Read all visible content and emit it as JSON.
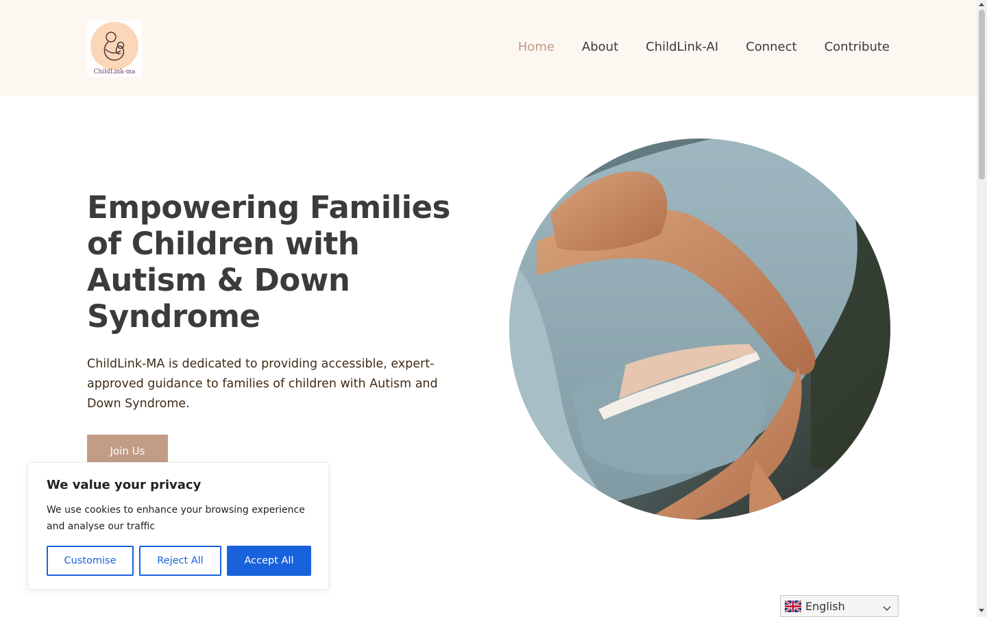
{
  "header": {
    "logo_text": "ChildLink-ma",
    "nav": [
      {
        "label": "Home",
        "active": true
      },
      {
        "label": "About"
      },
      {
        "label": "ChildLink-AI"
      },
      {
        "label": "Connect"
      },
      {
        "label": "Contribute"
      }
    ]
  },
  "hero": {
    "title": "Empowering Families of Children with Autism & Down Syndrome",
    "description": "ChildLink-MA is dedicated to providing accessible, expert-approved guidance to families of children with Autism and Down Syndrome.",
    "cta_label": "Join Us"
  },
  "cookie_banner": {
    "title": "We value your privacy",
    "text": "We use cookies to enhance your browsing experience and analyse our traffic",
    "customise_label": "Customise",
    "reject_label": "Reject All",
    "accept_label": "Accept All"
  },
  "language": {
    "selected": "English",
    "flag_icon": "uk-flag-icon"
  },
  "colors": {
    "accent": "#c29a83",
    "header_bg": "#fdf7f2",
    "button_bg": "#c39c85",
    "cookie_blue": "#1863dc"
  }
}
